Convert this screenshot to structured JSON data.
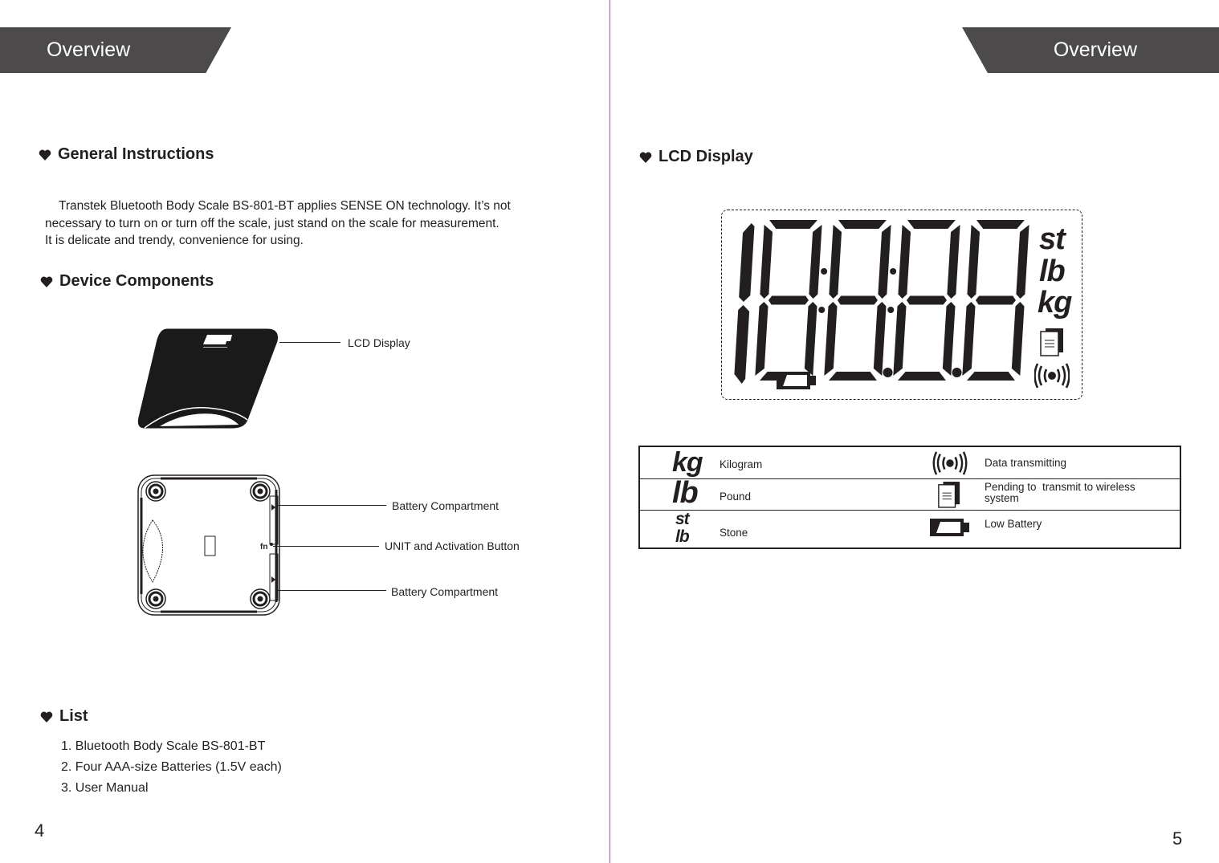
{
  "left_page": {
    "banner_title": "Overview",
    "sections": {
      "general": {
        "title": "General Instructions",
        "lines": [
          "    Transtek Bluetooth Body Scale BS-801-BT applies SENSE ON technology. It’s not",
          "necessary to turn on or turn off the scale, just stand on the scale for measurement.",
          "It is delicate and trendy, convenience for using."
        ]
      },
      "components": {
        "title": "Device Components",
        "callouts": {
          "lcd": "LCD Display",
          "battery_top": "Battery Compartment",
          "unit_button": "UNIT and Activation Button",
          "battery_bottom": "Battery Compartment"
        }
      },
      "list": {
        "title": "List",
        "items": [
          "1. Bluetooth Body Scale BS-801-BT",
          "2. Four AAA-size Batteries (1.5V each)",
          "3. User Manual"
        ]
      }
    },
    "page_number": "4"
  },
  "right_page": {
    "banner_title": "Overview",
    "lcd_section": {
      "title": "LCD Display",
      "display_units": [
        "st",
        "lb",
        "kg"
      ],
      "icons": [
        "memory-icon",
        "transmit-icon",
        "battery-low-icon"
      ]
    },
    "legend": {
      "rows": [
        {
          "unit_symbol": [
            "kg"
          ],
          "unit_label": "Kilogram",
          "icon": "transmit-icon",
          "icon_label": "Data transmitting"
        },
        {
          "unit_symbol": [
            "lb"
          ],
          "unit_label": "Pound",
          "icon": "memory-icon",
          "icon_label_lines": [
            "Pending to  transmit to wireless",
            "system"
          ]
        },
        {
          "unit_symbol": [
            "st",
            "lb"
          ],
          "unit_label": "Stone",
          "icon": "battery-low-icon",
          "icon_label": "Low Battery"
        }
      ]
    },
    "page_number": "5"
  },
  "colors": {
    "banner_bg": "#4d4a4b",
    "banner_text": "#ffffff",
    "text": "#231f20",
    "divider": "#d64a9a"
  }
}
